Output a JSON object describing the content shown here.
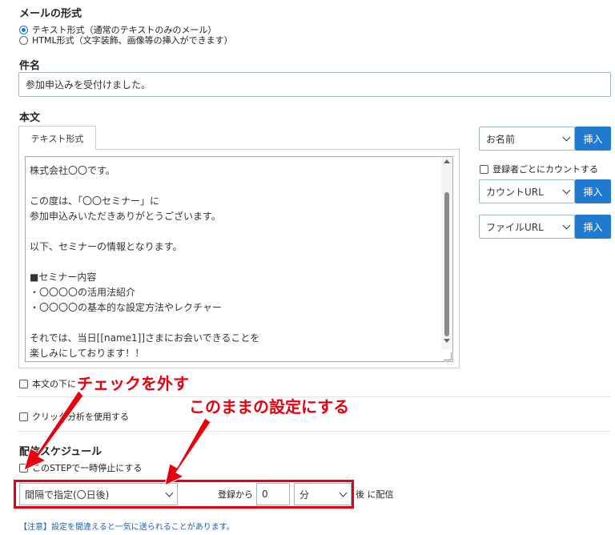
{
  "mail_format": {
    "title": "メールの形式",
    "options": [
      {
        "label": "テキスト形式（通常のテキストのみのメール）",
        "checked": true
      },
      {
        "label": "HTML形式（文字装飾、画像等の挿入ができます）",
        "checked": false
      }
    ]
  },
  "subject": {
    "title": "件名",
    "value": "参加申込みを受付けました。"
  },
  "body": {
    "title": "本文",
    "tab_label": "テキスト形式",
    "lines": [
      "株式会社〇〇です。",
      "",
      "この度は、「〇〇セミナー」に",
      "参加申込みいただきありがとうございます。",
      "",
      "以下、セミナーの情報となります。",
      "",
      "■セミナー内容",
      "・〇〇〇〇の活用法紹介",
      "・〇〇〇〇の基本的な設定方法やレクチャー",
      "",
      "それでは、当日[[name1]]さまにお会いできることを",
      "楽しみにしております！！"
    ]
  },
  "insert_panel": {
    "name_select": "お名前",
    "insert_label": "挿入",
    "count_checkbox": "登録者ごとにカウントする",
    "count_url_select": "カウントURL",
    "file_url_select": "ファイルURL"
  },
  "body_bottom_checkbox": "本文の下に",
  "click_analysis_checkbox": "クリック分析を使用する",
  "schedule": {
    "title": "配信スケジュール",
    "pause_checkbox": "このSTEPで一時停止にする",
    "interval_select": "間隔で指定(〇日後)",
    "from_label": "登録から",
    "amount_value": "0",
    "unit_select": "分",
    "after_label": "後 に配信"
  },
  "note": "【注意】設定を間違えると一気に送られることがあります。",
  "annotations": {
    "uncheck": "チェックを外す",
    "keep_setting": "このままの設定にする"
  },
  "colors": {
    "accent": "#1f7ad0",
    "annotation": "#e8000f"
  }
}
